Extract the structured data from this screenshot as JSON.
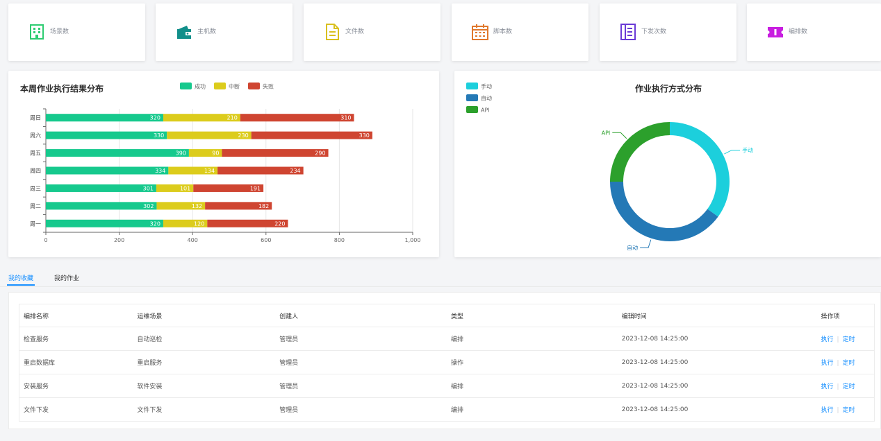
{
  "stats": [
    {
      "label": "场景数",
      "icon": "building-icon",
      "color": "#2ecc71"
    },
    {
      "label": "主机数",
      "icon": "wallet-icon",
      "color": "#118f8a"
    },
    {
      "label": "文件数",
      "icon": "file-icon",
      "color": "#d9c020"
    },
    {
      "label": "脚本数",
      "icon": "calendar-icon",
      "color": "#e0782c"
    },
    {
      "label": "下发次数",
      "icon": "list-icon",
      "color": "#6a3ad6"
    },
    {
      "label": "编排数",
      "icon": "ticket-icon",
      "color": "#c81ee0"
    }
  ],
  "bar_panel": {
    "title": "本周作业执行结果分布"
  },
  "pie_panel": {
    "title": "作业执行方式分布"
  },
  "chart_data": [
    {
      "type": "bar",
      "orientation": "horizontal",
      "stacked": true,
      "title": "本周作业执行结果分布",
      "categories": [
        "周日",
        "周六",
        "周五",
        "周四",
        "周三",
        "周二",
        "周一"
      ],
      "series": [
        {
          "name": "成功",
          "color": "#16c98d",
          "values": [
            320,
            330,
            390,
            334,
            301,
            302,
            320
          ]
        },
        {
          "name": "中断",
          "color": "#dccc1c",
          "values": [
            210,
            230,
            90,
            134,
            101,
            132,
            120
          ]
        },
        {
          "name": "失败",
          "color": "#cf4531",
          "values": [
            310,
            330,
            290,
            234,
            191,
            182,
            220
          ]
        }
      ],
      "xlim": [
        0,
        1000
      ],
      "xticks": [
        "0",
        "200",
        "400",
        "600",
        "800",
        "1,000"
      ],
      "grid": true,
      "legend": "top"
    },
    {
      "type": "pie",
      "variant": "donut",
      "title": "作业执行方式分布",
      "slices": [
        {
          "name": "手动",
          "value": 35,
          "color": "#1ccfdc"
        },
        {
          "name": "自动",
          "value": 40,
          "color": "#2479b6"
        },
        {
          "name": "API",
          "value": 25,
          "color": "#2ca02c"
        }
      ],
      "legend": "top-left"
    }
  ],
  "tabs": [
    {
      "label": "我的收藏",
      "active": true
    },
    {
      "label": "我的作业",
      "active": false
    }
  ],
  "table": {
    "headers": [
      "编排名称",
      "运维场景",
      "创建人",
      "类型",
      "编辑时间",
      "操作项"
    ],
    "rows": [
      [
        "检查服务",
        "自动巡检",
        "管理员",
        "编排",
        "2023-12-08 14:25:00"
      ],
      [
        "重启数据库",
        "重启服务",
        "管理员",
        "操作",
        "2023-12-08 14:25:00"
      ],
      [
        "安装服务",
        "软件安装",
        "管理员",
        "编排",
        "2023-12-08 14:25:00"
      ],
      [
        "文件下发",
        "文件下发",
        "管理员",
        "编排",
        "2023-12-08 14:25:00"
      ]
    ],
    "actions": {
      "execute": "执行",
      "separator": "|",
      "schedule": "定时"
    }
  }
}
